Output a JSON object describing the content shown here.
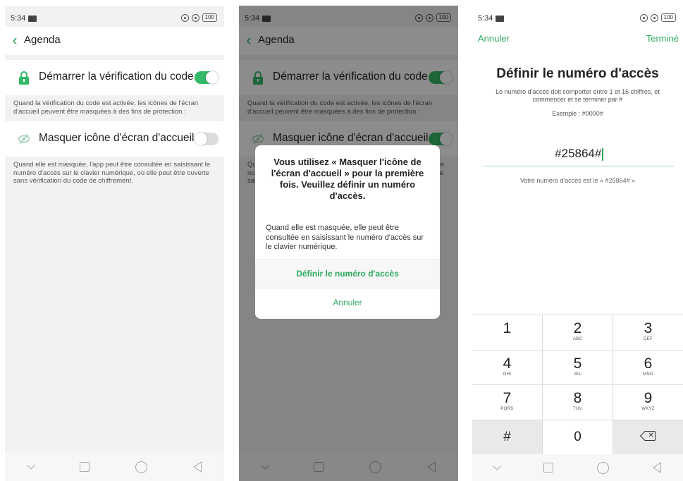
{
  "colors": {
    "accent": "#2eab60",
    "toggle_on": "#35b868",
    "toggle_off": "#dcdcdc",
    "background": "#f2f2f2"
  },
  "status_bar": {
    "time": "5:34",
    "battery": "100"
  },
  "settings": {
    "back_icon": "chevron-left-icon",
    "title": "Agenda",
    "code_row": {
      "icon": "lock-icon",
      "label": "Démarrer la vérification du code",
      "enabled": true
    },
    "code_desc": "Quand la vérification du code est activée, les icônes de l'écran d'accueil peuvent être masquées à des fins de protection :",
    "hide_row": {
      "icon": "eye-slash-icon",
      "label": "Masquer icône d'écran d'accueil"
    },
    "hide_desc": "Quand elle est masquée, l'app peut être consultée en saisissant le numéro d'accès sur le clavier numérique, où elle peut être ouverte sans vérification du code de chiffrement.",
    "hide_enabled_screen1": false,
    "hide_enabled_screen2": true
  },
  "dialog": {
    "title": "Vous utilisez « Masquer l'icône de l'écran d'accueil » pour la première fois. Veuillez définir un numéro d'accès.",
    "message": "Quand elle est masquée, elle peut être consultée en saisissant le numéro d'accès sur le clavier numérique.",
    "primary_button": "Définir le numéro d'accès",
    "cancel_button": "Annuler"
  },
  "access_number": {
    "cancel": "Annuler",
    "done": "Terminé",
    "title": "Définir le numéro d'accès",
    "subtitle": "Le numéro d'accès doit comporter entre 1 et 16 chiffres, et commencer et se terminer par #",
    "example": "Exemple : #0000#",
    "value": "#25864#",
    "hint": "Votre numéro d'accès est le « #25864# »"
  },
  "keypad": [
    {
      "num": "1",
      "letters": ""
    },
    {
      "num": "2",
      "letters": "ABC"
    },
    {
      "num": "3",
      "letters": "DEF"
    },
    {
      "num": "4",
      "letters": "GHI"
    },
    {
      "num": "5",
      "letters": "JKL"
    },
    {
      "num": "6",
      "letters": "MNO"
    },
    {
      "num": "7",
      "letters": "PQRS"
    },
    {
      "num": "8",
      "letters": "TUV"
    },
    {
      "num": "9",
      "letters": "WXYZ"
    },
    {
      "num": "#",
      "letters": ""
    },
    {
      "num": "0",
      "letters": ""
    },
    {
      "num": "",
      "letters": "",
      "icon": "backspace-icon"
    }
  ],
  "navbar": {
    "icons": [
      "chevron-down-icon",
      "square-icon",
      "circle-icon",
      "triangle-back-icon"
    ]
  }
}
